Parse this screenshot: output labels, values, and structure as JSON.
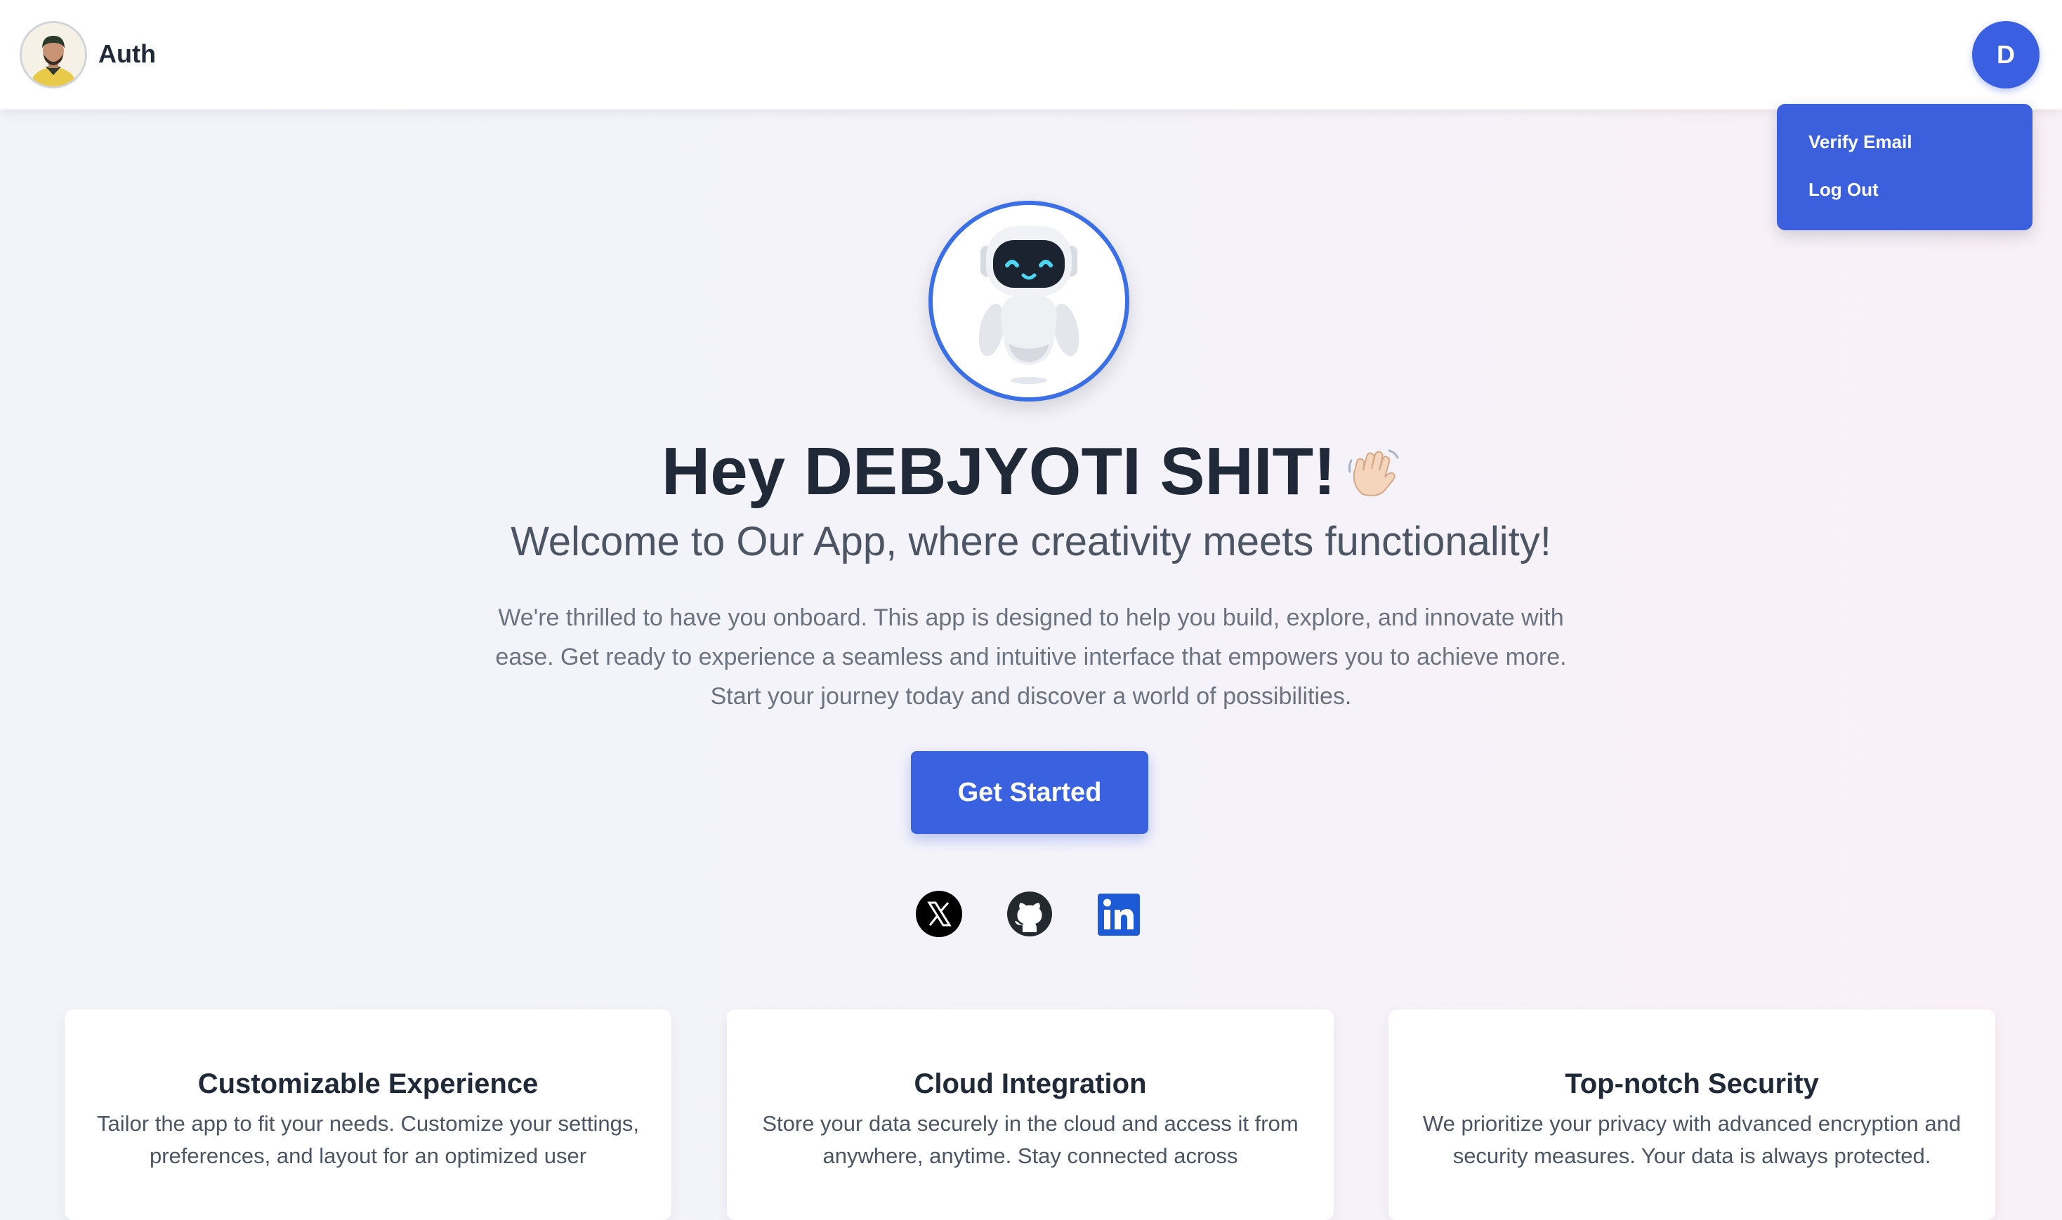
{
  "navbar": {
    "logo_text": "Auth",
    "user_initial": "D"
  },
  "dropdown": {
    "items": [
      {
        "label": "Verify Email"
      },
      {
        "label": "Log Out"
      }
    ],
    "background": "#3b5fdd"
  },
  "hero": {
    "title": "Hey DEBJYOTI SHIT!",
    "subtitle": "Welcome to Our App, where creativity meets functionality!",
    "description": "We're thrilled to have you onboard. This app is designed to help you build, explore, and innovate with ease. Get ready to experience a seamless and intuitive interface that empowers you to achieve more. Start your journey today and discover a world of possibilities.",
    "cta_label": "Get Started",
    "accent_color": "#3961e0"
  },
  "social": [
    {
      "icon": "x-icon"
    },
    {
      "icon": "github-icon"
    },
    {
      "icon": "linkedin-icon"
    }
  ],
  "features": [
    {
      "title": "Customizable Experience",
      "text": "Tailor the app to fit your needs. Customize your settings, preferences, and layout for an optimized user"
    },
    {
      "title": "Cloud Integration",
      "text": "Store your data securely in the cloud and access it from anywhere, anytime. Stay connected across"
    },
    {
      "title": "Top-notch Security",
      "text": "We prioritize your privacy with advanced encryption and security measures. Your data is always protected."
    }
  ]
}
